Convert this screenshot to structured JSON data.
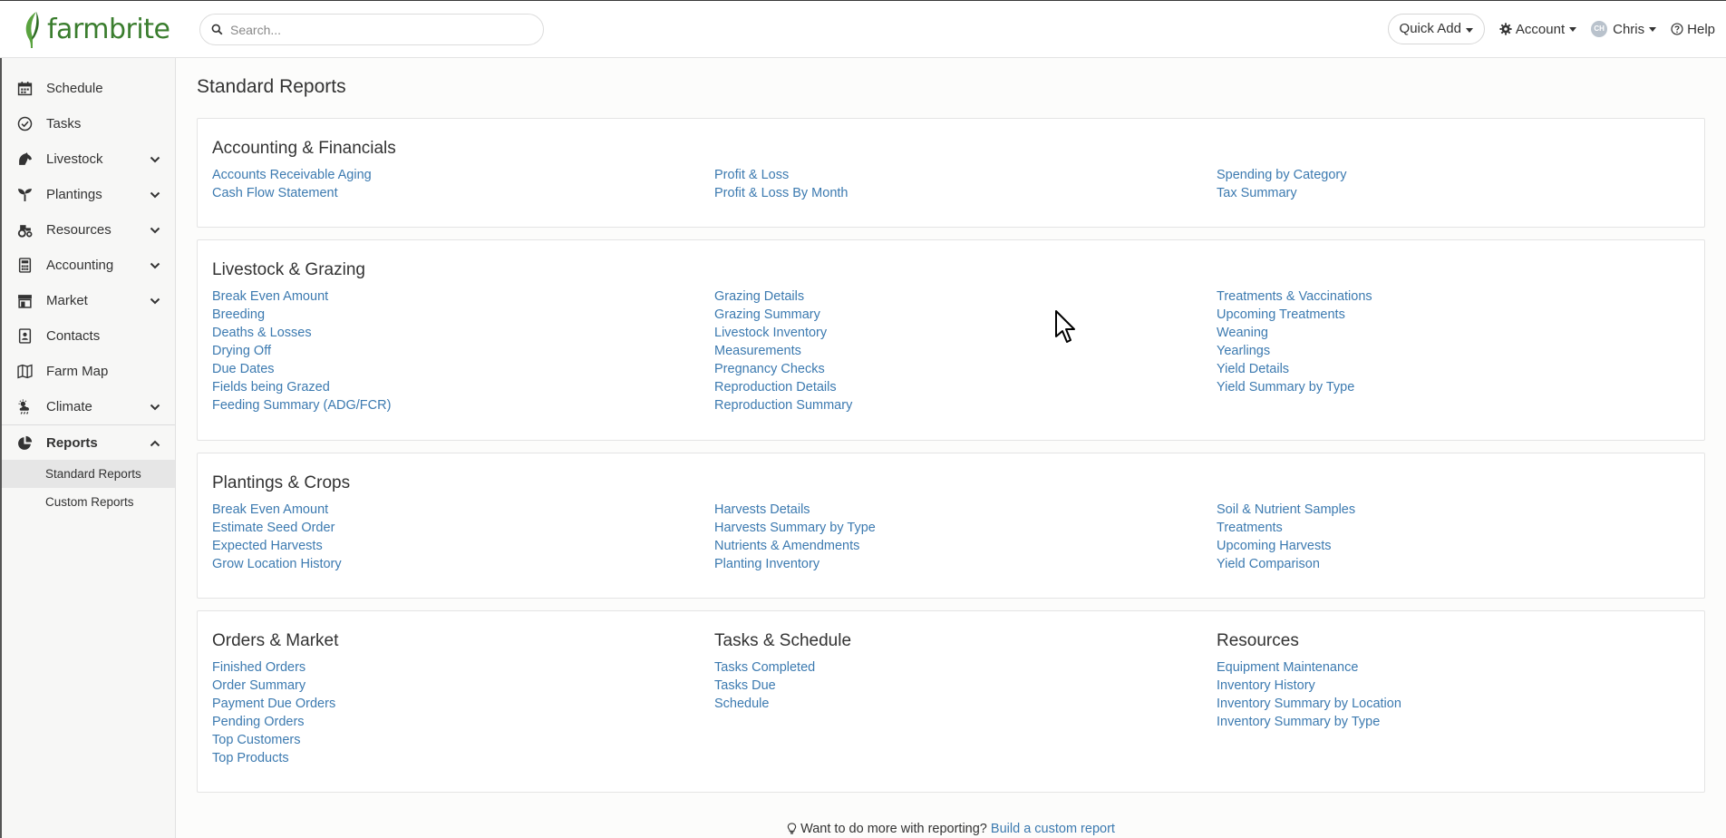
{
  "brand": {
    "name": "farmbrite"
  },
  "search": {
    "placeholder": "Search..."
  },
  "topnav": {
    "quick_add": "Quick Add",
    "account": "Account",
    "user_initials": "CH",
    "user": "Chris",
    "help": "Help"
  },
  "sidebar": {
    "items": [
      {
        "label": "Schedule",
        "icon": "calendar-icon"
      },
      {
        "label": "Tasks",
        "icon": "check-circle-icon"
      },
      {
        "label": "Livestock",
        "icon": "horse-icon",
        "expandable": true
      },
      {
        "label": "Plantings",
        "icon": "seedling-icon",
        "expandable": true
      },
      {
        "label": "Resources",
        "icon": "tractor-icon",
        "expandable": true
      },
      {
        "label": "Accounting",
        "icon": "calculator-icon",
        "expandable": true
      },
      {
        "label": "Market",
        "icon": "store-icon",
        "expandable": true
      },
      {
        "label": "Contacts",
        "icon": "address-book-icon"
      },
      {
        "label": "Farm Map",
        "icon": "map-icon"
      },
      {
        "label": "Climate",
        "icon": "cloud-sun-icon",
        "expandable": true
      },
      {
        "label": "Reports",
        "icon": "pie-chart-icon",
        "expanded": true
      }
    ],
    "sub_items": [
      "Standard Reports",
      "Custom Reports"
    ]
  },
  "page": {
    "title": "Standard Reports"
  },
  "sections": {
    "accounting": {
      "title": "Accounting & Financials",
      "columns": [
        [
          "Accounts Receivable Aging",
          "Cash Flow Statement"
        ],
        [
          "Profit & Loss",
          "Profit & Loss By Month"
        ],
        [
          "Spending by Category",
          "Tax Summary"
        ]
      ]
    },
    "livestock": {
      "title": "Livestock & Grazing",
      "columns": [
        [
          "Break Even Amount",
          "Breeding",
          "Deaths & Losses",
          "Drying Off",
          "Due Dates",
          "Fields being Grazed",
          "Feeding Summary (ADG/FCR)"
        ],
        [
          "Grazing Details",
          "Grazing Summary",
          "Livestock Inventory",
          "Measurements",
          "Pregnancy Checks",
          "Reproduction Details",
          "Reproduction Summary"
        ],
        [
          "Treatments & Vaccinations",
          "Upcoming Treatments",
          "Weaning",
          "Yearlings",
          "Yield Details",
          "Yield Summary by Type"
        ]
      ]
    },
    "plantings": {
      "title": "Plantings & Crops",
      "columns": [
        [
          "Break Even Amount",
          "Estimate Seed Order",
          "Expected Harvests",
          "Grow Location History"
        ],
        [
          "Harvests Details",
          "Harvests Summary by Type",
          "Nutrients & Amendments",
          "Planting Inventory"
        ],
        [
          "Soil & Nutrient Samples",
          "Treatments",
          "Upcoming Harvests",
          "Yield Comparison"
        ]
      ]
    },
    "orders": {
      "title": "Orders & Market",
      "links": [
        "Finished Orders",
        "Order Summary",
        "Payment Due Orders",
        "Pending Orders",
        "Top Customers",
        "Top Products"
      ]
    },
    "tasks": {
      "title": "Tasks & Schedule",
      "links": [
        "Tasks Completed",
        "Tasks Due",
        "Schedule"
      ]
    },
    "resources": {
      "title": "Resources",
      "links": [
        "Equipment Maintenance",
        "Inventory History",
        "Inventory Summary by Location",
        "Inventory Summary by Type"
      ]
    }
  },
  "footer": {
    "text": "Want to do more with reporting?",
    "link": "Build a custom report"
  }
}
